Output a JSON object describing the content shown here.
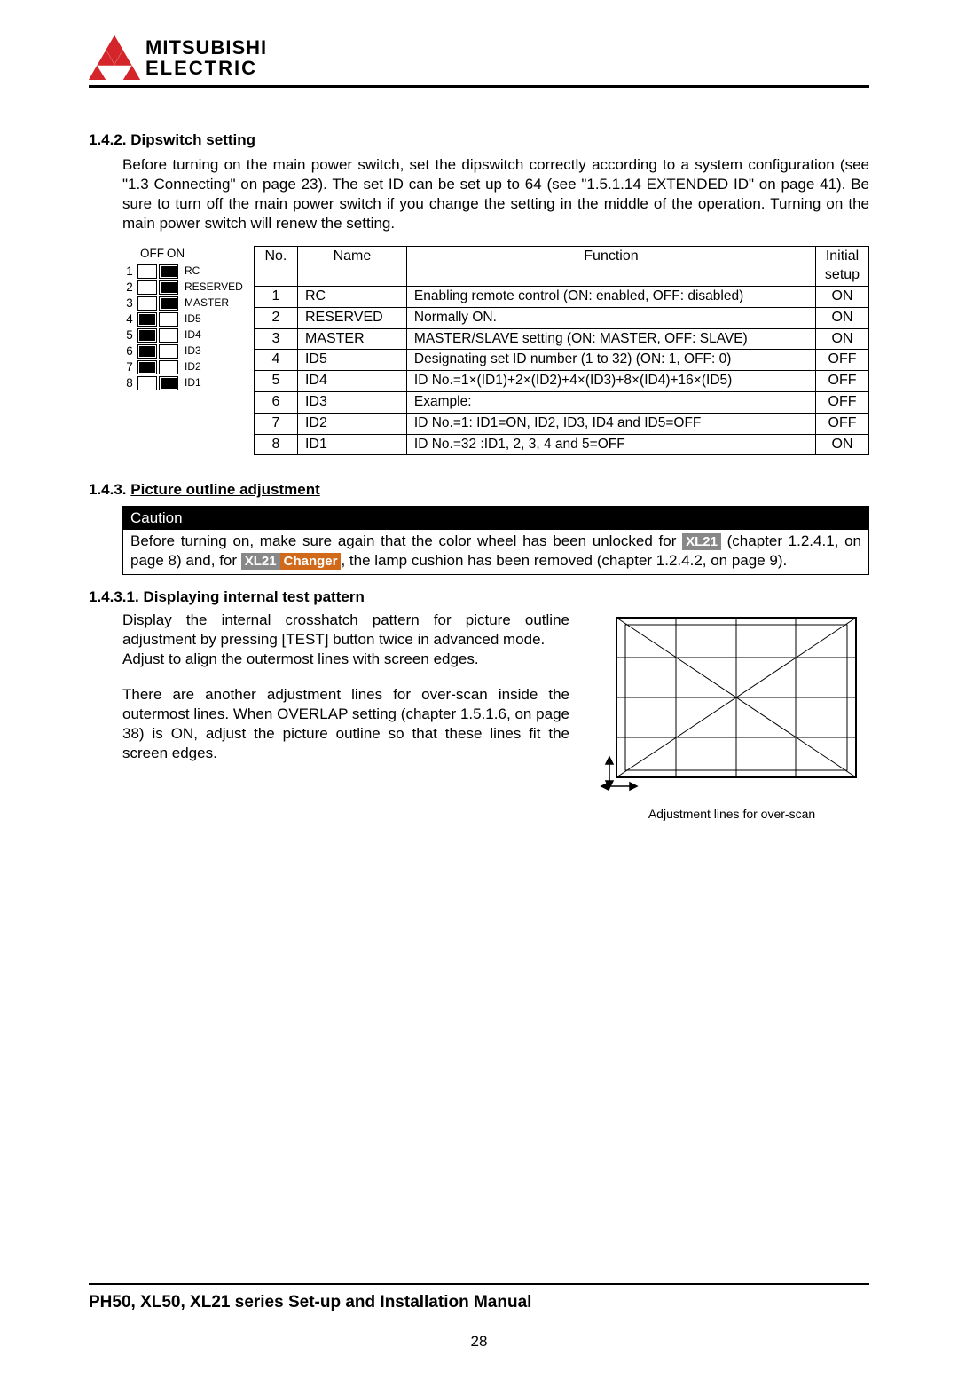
{
  "header": {
    "brand_line1": "MITSUBISHI",
    "brand_line2": "ELECTRIC"
  },
  "section_142": {
    "number": "1.4.2.",
    "title": "Dipswitch setting",
    "paragraph": "Before turning on the main power switch, set the dipswitch correctly according to a system configuration (see \"1.3 Connecting\" on page 23). The set ID can be set up to 64 (see \"1.5.1.14 EXTENDED ID\" on page 41). Be sure to turn off the main power switch if you change the setting in the middle of the operation. Turning on the main power switch will renew the setting."
  },
  "dipswitch_diagram": {
    "off_label": "OFF",
    "on_label": "ON",
    "rows": [
      {
        "n": "1",
        "off": false,
        "on": true,
        "label": "RC"
      },
      {
        "n": "2",
        "off": false,
        "on": true,
        "label": "RESERVED"
      },
      {
        "n": "3",
        "off": false,
        "on": true,
        "label": "MASTER"
      },
      {
        "n": "4",
        "off": true,
        "on": false,
        "label": "ID5"
      },
      {
        "n": "5",
        "off": true,
        "on": false,
        "label": "ID4"
      },
      {
        "n": "6",
        "off": true,
        "on": false,
        "label": "ID3"
      },
      {
        "n": "7",
        "off": true,
        "on": false,
        "label": "ID2"
      },
      {
        "n": "8",
        "off": false,
        "on": true,
        "label": "ID1"
      }
    ]
  },
  "dip_table": {
    "headers": {
      "no": "No.",
      "name": "Name",
      "function": "Function",
      "initial": "Initial setup"
    },
    "rows": [
      {
        "no": "1",
        "name": "RC",
        "func": "Enabling remote control (ON: enabled, OFF: disabled)",
        "init": "ON"
      },
      {
        "no": "2",
        "name": "RESERVED",
        "func": "Normally ON.",
        "init": "ON"
      },
      {
        "no": "3",
        "name": "MASTER",
        "func": "MASTER/SLAVE setting (ON: MASTER, OFF: SLAVE)",
        "init": "ON"
      },
      {
        "no": "4",
        "name": "ID5",
        "func": "Designating set ID number (1 to 32) (ON: 1, OFF: 0)",
        "init": "OFF"
      },
      {
        "no": "5",
        "name": "ID4",
        "func": "ID No.=1×(ID1)+2×(ID2)+4×(ID3)+8×(ID4)+16×(ID5)",
        "init": "OFF"
      },
      {
        "no": "6",
        "name": "ID3",
        "func": "Example:",
        "init": "OFF"
      },
      {
        "no": "7",
        "name": "ID2",
        "func": "  ID No.=1: ID1=ON, ID2, ID3, ID4 and ID5=OFF",
        "init": "OFF"
      },
      {
        "no": "8",
        "name": "ID1",
        "func": "  ID No.=32 :ID1, 2, 3, 4 and 5=OFF",
        "init": "ON"
      }
    ]
  },
  "section_143": {
    "number": "1.4.3.",
    "title": "Picture outline adjustment"
  },
  "caution": {
    "title": "Caution",
    "text_before_badge1": "Before turning on, make sure again that the color wheel has been unlocked for ",
    "badge1": "XL21",
    "text_mid": " (chapter 1.2.4.1, on page 8) and, for ",
    "badge2a": "XL21",
    "badge2b": "Changer",
    "text_after": ", the lamp cushion has been removed (chapter 1.2.4.2, on page 9)."
  },
  "section_1431": {
    "number": "1.4.3.1.",
    "title": "Displaying internal test pattern",
    "para1": "Display the internal crosshatch pattern for picture outline adjustment by pressing [TEST] button twice in advanced mode.",
    "para2": "Adjust to align the outermost lines with screen edges.",
    "para3": "There are another adjustment lines for over-scan inside the outermost lines. When OVERLAP setting (chapter 1.5.1.6, on page 38) is ON, adjust the picture outline so that these lines fit the screen edges.",
    "caption": "Adjustment lines for over-scan"
  },
  "footer": {
    "title": "PH50, XL50, XL21 series Set-up and Installation Manual",
    "page": "28"
  }
}
